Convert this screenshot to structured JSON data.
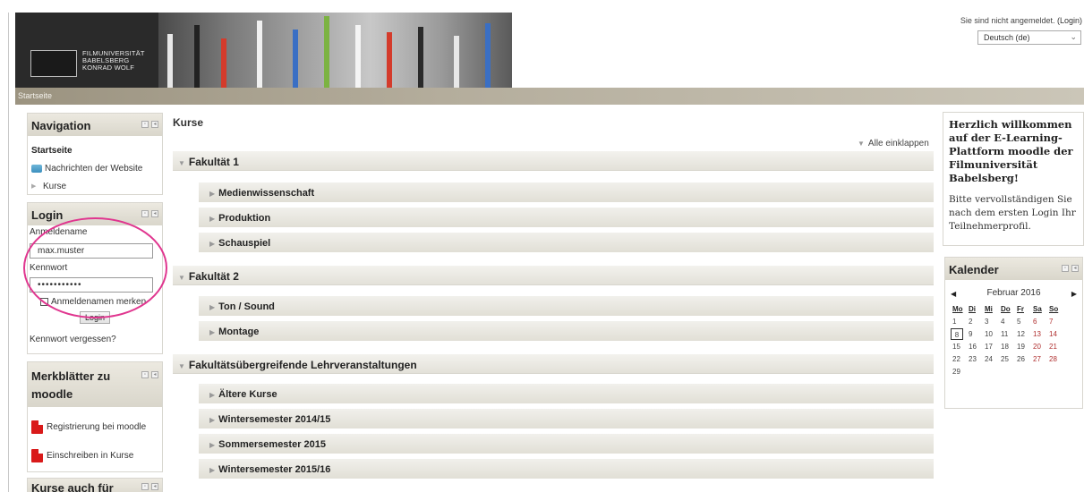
{
  "header": {
    "logo_lines": [
      "FILMUNIVERSITÄT",
      "BABELSBERG",
      "KONRAD WOLF"
    ],
    "login_status_text": "Sie sind nicht angemeldet.",
    "login_link": "(Login)",
    "language": "Deutsch (de)"
  },
  "breadcrumb": {
    "home": "Startseite"
  },
  "navigation": {
    "title": "Navigation",
    "home": "Startseite",
    "items": [
      {
        "label": "Nachrichten der Website",
        "icon": "forum-icon"
      },
      {
        "label": "Kurse",
        "icon": "triangle-right-icon"
      }
    ]
  },
  "login": {
    "title": "Login",
    "username_label": "Anmeldename",
    "username_value": "max.muster",
    "password_label": "Kennwort",
    "password_value": "•••••••••••",
    "remember_label": "Anmeldenamen merken",
    "submit": "Login",
    "forgot": "Kennwort vergessen?"
  },
  "handouts": {
    "title_line1": "Merkblätter zu",
    "title_line2": "moodle",
    "items": [
      {
        "label": "Registrierung bei moodle"
      },
      {
        "label": "Einschreiben in Kurse"
      }
    ]
  },
  "courses_for": {
    "title": "Kurse auch für"
  },
  "main": {
    "title": "Kurse",
    "collapse_all": "Alle einklappen",
    "categories": [
      {
        "label": "Fakultät 1",
        "subs": [
          "Medienwissenschaft",
          "Produktion",
          "Schauspiel"
        ]
      },
      {
        "label": "Fakultät 2",
        "subs": [
          "Ton / Sound",
          "Montage"
        ]
      },
      {
        "label": "Fakultätsübergreifende Lehrveranstaltungen",
        "subs": [
          "Ältere Kurse",
          "Wintersemester 2014/15",
          "Sommersemester 2015",
          "Wintersemester 2015/16"
        ]
      }
    ]
  },
  "welcome": {
    "title": "Herzlich willkommen auf der E-Learning-Plattform moodle der Filmuniversität Babelsberg!",
    "text": "Bitte vervollständigen Sie nach dem ersten Login Ihr Teilnehmerprofil."
  },
  "calendar": {
    "title": "Kalender",
    "month": "Februar 2016",
    "weekdays": [
      "Mo",
      "Di",
      "Mi",
      "Do",
      "Fr",
      "Sa",
      "So"
    ],
    "days": [
      "1",
      "2",
      "3",
      "4",
      "5",
      "6",
      "7",
      "8",
      "9",
      "10",
      "11",
      "12",
      "13",
      "14",
      "15",
      "16",
      "17",
      "18",
      "19",
      "20",
      "21",
      "22",
      "23",
      "24",
      "25",
      "26",
      "27",
      "28",
      "29"
    ],
    "today": "8"
  },
  "colors": {
    "highlight_circle": "#e0368f",
    "navbar": "#b4ad9c"
  }
}
